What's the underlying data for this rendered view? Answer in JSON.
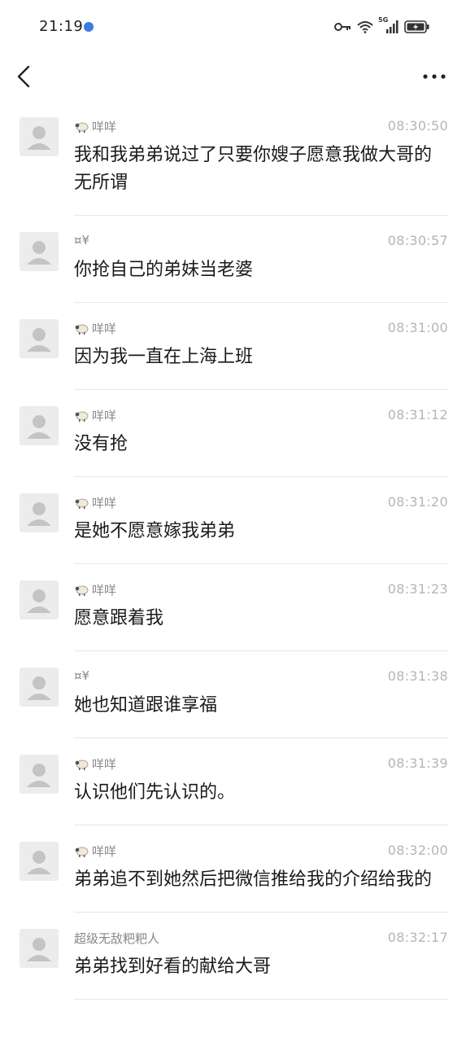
{
  "status": {
    "time": "21:19",
    "network_label": "5G"
  },
  "nav": {
    "back_icon": "chevron-left-icon",
    "more_icon": "more-horizontal-icon"
  },
  "messages": [
    {
      "sender": "咩咩",
      "sheep": true,
      "time": "08:30:50",
      "text": "我和我弟弟说过了只要你嫂子愿意我做大哥的无所谓"
    },
    {
      "sender": "¤¥",
      "sheep": false,
      "time": "08:30:57",
      "text": "你抢自己的弟妹当老婆"
    },
    {
      "sender": "咩咩",
      "sheep": true,
      "time": "08:31:00",
      "text": "因为我一直在上海上班"
    },
    {
      "sender": "咩咩",
      "sheep": true,
      "time": "08:31:12",
      "text": "没有抢"
    },
    {
      "sender": "咩咩",
      "sheep": true,
      "time": "08:31:20",
      "text": "是她不愿意嫁我弟弟"
    },
    {
      "sender": "咩咩",
      "sheep": true,
      "time": "08:31:23",
      "text": "愿意跟着我"
    },
    {
      "sender": "¤¥",
      "sheep": false,
      "time": "08:31:38",
      "text": "她也知道跟谁享福"
    },
    {
      "sender": "咩咩",
      "sheep": true,
      "time": "08:31:39",
      "text": "认识他们先认识的。"
    },
    {
      "sender": "咩咩",
      "sheep": true,
      "time": "08:32:00",
      "text": "弟弟追不到她然后把微信推给我的介绍给我的"
    },
    {
      "sender": "超级无敌粑粑人",
      "sheep": false,
      "time": "08:32:17",
      "text": "弟弟找到好看的献给大哥"
    }
  ]
}
